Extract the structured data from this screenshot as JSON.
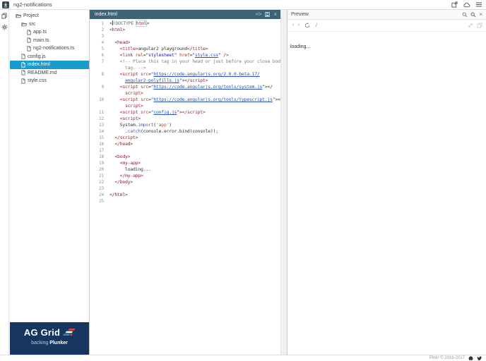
{
  "topbar": {
    "title": "ng2-notifications"
  },
  "icons": {
    "code": "</>",
    "close": "×",
    "back": "‹",
    "forward": "›"
  },
  "sidebar": {
    "tree": [
      {
        "label": "Project",
        "type": "folder",
        "depth": 0
      },
      {
        "label": "src",
        "type": "folder",
        "depth": 1
      },
      {
        "label": "app.ts",
        "type": "file",
        "depth": 2
      },
      {
        "label": "main.ts",
        "type": "file",
        "depth": 2
      },
      {
        "label": "ng2-notifications.ts",
        "type": "file",
        "depth": 2
      },
      {
        "label": "config.js",
        "type": "file",
        "depth": 1
      },
      {
        "label": "index.html",
        "type": "file",
        "depth": 1,
        "selected": true
      },
      {
        "label": "README.md",
        "type": "file",
        "depth": 1
      },
      {
        "label": "style.css",
        "type": "file",
        "depth": 1
      }
    ]
  },
  "sponsor": {
    "name": "AG Grid",
    "tagline_prefix": "backing ",
    "tagline_bold": "Plunker"
  },
  "editor": {
    "tab": "index.html",
    "rows": [
      {
        "n": "1",
        "t": [
          [
            "p",
            "<"
          ],
          [
            "cr",
            ""
          ],
          [
            "d",
            "!DOCTYPE "
          ],
          [
            "tb",
            "html"
          ],
          [
            "p",
            ">"
          ]
        ]
      },
      {
        "n": "2",
        "t": [
          [
            "t",
            "<html>"
          ]
        ]
      },
      {
        "n": "3",
        "t": []
      },
      {
        "n": "4",
        "t": [
          [
            "p",
            "  "
          ],
          [
            "t",
            "<head>"
          ]
        ]
      },
      {
        "n": "5",
        "t": [
          [
            "p",
            "    "
          ],
          [
            "t",
            "<title>"
          ],
          [
            "p",
            "angular2 playground"
          ],
          [
            "t",
            "</title>"
          ]
        ]
      },
      {
        "n": "6",
        "t": [
          [
            "p",
            "    "
          ],
          [
            "t",
            "<link "
          ],
          [
            "a",
            "rel"
          ],
          [
            "p",
            "="
          ],
          [
            "s",
            "\"stylesheet\""
          ],
          [
            "p",
            " "
          ],
          [
            "a",
            "href"
          ],
          [
            "p",
            "="
          ],
          [
            "s",
            "\""
          ],
          [
            "l",
            "style.css"
          ],
          [
            "s",
            "\""
          ],
          [
            "p",
            " "
          ],
          [
            "t",
            "/>"
          ]
        ]
      },
      {
        "n": "7",
        "t": [
          [
            "p",
            "    "
          ],
          [
            "c",
            "<!-- Place this tag in your head or just before your close body"
          ]
        ]
      },
      {
        "n": "",
        "t": [
          [
            "c",
            "      tag. -->"
          ]
        ]
      },
      {
        "n": "8",
        "t": [
          [
            "p",
            "    "
          ],
          [
            "t",
            "<script "
          ],
          [
            "a",
            "src"
          ],
          [
            "p",
            "="
          ],
          [
            "s",
            "\""
          ],
          [
            "l",
            "https://code.angularjs.org/2.0.0-beta.17/"
          ]
        ]
      },
      {
        "n": "",
        "t": [
          [
            "p",
            "      "
          ],
          [
            "l",
            "angular2-polyfills.js"
          ],
          [
            "s",
            "\""
          ],
          [
            "p",
            ">"
          ],
          [
            "t",
            "</script>"
          ]
        ]
      },
      {
        "n": "9",
        "t": [
          [
            "p",
            "    "
          ],
          [
            "t",
            "<script "
          ],
          [
            "a",
            "src"
          ],
          [
            "p",
            "="
          ],
          [
            "s",
            "\""
          ],
          [
            "l",
            "https://code.angularjs.org/tools/system.js"
          ],
          [
            "s",
            "\""
          ],
          [
            "p",
            "></"
          ]
        ]
      },
      {
        "n": "",
        "t": [
          [
            "p",
            "      "
          ],
          [
            "t",
            "script>"
          ]
        ]
      },
      {
        "n": "10",
        "t": [
          [
            "p",
            "    "
          ],
          [
            "t",
            "<script "
          ],
          [
            "a",
            "src"
          ],
          [
            "p",
            "="
          ],
          [
            "s",
            "\""
          ],
          [
            "l",
            "https://code.angularjs.org/tools/typescript.js"
          ],
          [
            "s",
            "\""
          ],
          [
            "p",
            "></"
          ]
        ]
      },
      {
        "n": "",
        "t": [
          [
            "p",
            "      "
          ],
          [
            "t",
            "script>"
          ]
        ]
      },
      {
        "n": "11",
        "t": [
          [
            "p",
            "    "
          ],
          [
            "t",
            "<script "
          ],
          [
            "a",
            "src"
          ],
          [
            "p",
            "="
          ],
          [
            "s",
            "\""
          ],
          [
            "l",
            "config.js"
          ],
          [
            "s",
            "\""
          ],
          [
            "p",
            ">"
          ],
          [
            "t",
            "</script>"
          ]
        ]
      },
      {
        "n": "12",
        "t": [
          [
            "p",
            "    "
          ],
          [
            "t",
            "<script>"
          ]
        ]
      },
      {
        "n": "13",
        "t": [
          [
            "p",
            "    System."
          ],
          [
            "k",
            "import"
          ],
          [
            "p",
            "("
          ],
          [
            "o",
            "'app'"
          ],
          [
            "p",
            ")"
          ]
        ]
      },
      {
        "n": "14",
        "t": [
          [
            "p",
            "      ."
          ],
          [
            "k",
            "catch"
          ],
          [
            "p",
            "(console.error.bind(console));"
          ]
        ]
      },
      {
        "n": "15",
        "t": [
          [
            "p",
            "  "
          ],
          [
            "t",
            "</script>"
          ]
        ]
      },
      {
        "n": "16",
        "t": [
          [
            "p",
            "  "
          ],
          [
            "t",
            "</head>"
          ]
        ]
      },
      {
        "n": "17",
        "t": []
      },
      {
        "n": "18",
        "t": [
          [
            "p",
            "  "
          ],
          [
            "t",
            "<body>"
          ]
        ]
      },
      {
        "n": "19",
        "t": [
          [
            "p",
            "    "
          ],
          [
            "t",
            "<my-app>"
          ]
        ]
      },
      {
        "n": "20",
        "t": [
          [
            "p",
            "      loading..."
          ]
        ]
      },
      {
        "n": "21",
        "t": [
          [
            "p",
            "    "
          ],
          [
            "t",
            "</my-app>"
          ]
        ]
      },
      {
        "n": "22",
        "t": [
          [
            "p",
            "  "
          ],
          [
            "t",
            "</body>"
          ]
        ]
      },
      {
        "n": "23",
        "t": []
      },
      {
        "n": "24",
        "t": [
          [
            "t",
            "</html>"
          ]
        ]
      },
      {
        "n": "25",
        "t": []
      }
    ]
  },
  "preview": {
    "title": "Preview",
    "path": "/",
    "loading_text": "loading..."
  },
  "footer": {
    "copyright": "Plnkr © 2016-2017"
  },
  "colors": {
    "tab_bar": "#3d6374",
    "selected_file_bg": "#189bce",
    "sponsor_bg": "#16365f",
    "ag_red": "#e8432e",
    "ag_blue": "#3d7fb5",
    "tag": "#8b2332",
    "string": "#1a1aa6",
    "link": "#2a50bb"
  }
}
